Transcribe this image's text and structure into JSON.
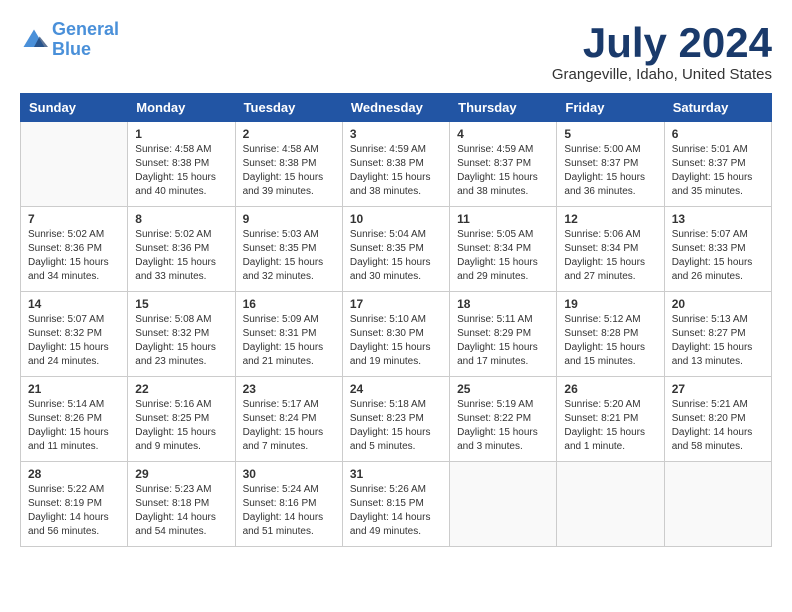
{
  "header": {
    "logo_line1": "General",
    "logo_line2": "Blue",
    "month_title": "July 2024",
    "location": "Grangeville, Idaho, United States"
  },
  "days_of_week": [
    "Sunday",
    "Monday",
    "Tuesday",
    "Wednesday",
    "Thursday",
    "Friday",
    "Saturday"
  ],
  "weeks": [
    [
      {
        "day": "",
        "content": ""
      },
      {
        "day": "1",
        "content": "Sunrise: 4:58 AM\nSunset: 8:38 PM\nDaylight: 15 hours\nand 40 minutes."
      },
      {
        "day": "2",
        "content": "Sunrise: 4:58 AM\nSunset: 8:38 PM\nDaylight: 15 hours\nand 39 minutes."
      },
      {
        "day": "3",
        "content": "Sunrise: 4:59 AM\nSunset: 8:38 PM\nDaylight: 15 hours\nand 38 minutes."
      },
      {
        "day": "4",
        "content": "Sunrise: 4:59 AM\nSunset: 8:37 PM\nDaylight: 15 hours\nand 38 minutes."
      },
      {
        "day": "5",
        "content": "Sunrise: 5:00 AM\nSunset: 8:37 PM\nDaylight: 15 hours\nand 36 minutes."
      },
      {
        "day": "6",
        "content": "Sunrise: 5:01 AM\nSunset: 8:37 PM\nDaylight: 15 hours\nand 35 minutes."
      }
    ],
    [
      {
        "day": "7",
        "content": "Sunrise: 5:02 AM\nSunset: 8:36 PM\nDaylight: 15 hours\nand 34 minutes."
      },
      {
        "day": "8",
        "content": "Sunrise: 5:02 AM\nSunset: 8:36 PM\nDaylight: 15 hours\nand 33 minutes."
      },
      {
        "day": "9",
        "content": "Sunrise: 5:03 AM\nSunset: 8:35 PM\nDaylight: 15 hours\nand 32 minutes."
      },
      {
        "day": "10",
        "content": "Sunrise: 5:04 AM\nSunset: 8:35 PM\nDaylight: 15 hours\nand 30 minutes."
      },
      {
        "day": "11",
        "content": "Sunrise: 5:05 AM\nSunset: 8:34 PM\nDaylight: 15 hours\nand 29 minutes."
      },
      {
        "day": "12",
        "content": "Sunrise: 5:06 AM\nSunset: 8:34 PM\nDaylight: 15 hours\nand 27 minutes."
      },
      {
        "day": "13",
        "content": "Sunrise: 5:07 AM\nSunset: 8:33 PM\nDaylight: 15 hours\nand 26 minutes."
      }
    ],
    [
      {
        "day": "14",
        "content": "Sunrise: 5:07 AM\nSunset: 8:32 PM\nDaylight: 15 hours\nand 24 minutes."
      },
      {
        "day": "15",
        "content": "Sunrise: 5:08 AM\nSunset: 8:32 PM\nDaylight: 15 hours\nand 23 minutes."
      },
      {
        "day": "16",
        "content": "Sunrise: 5:09 AM\nSunset: 8:31 PM\nDaylight: 15 hours\nand 21 minutes."
      },
      {
        "day": "17",
        "content": "Sunrise: 5:10 AM\nSunset: 8:30 PM\nDaylight: 15 hours\nand 19 minutes."
      },
      {
        "day": "18",
        "content": "Sunrise: 5:11 AM\nSunset: 8:29 PM\nDaylight: 15 hours\nand 17 minutes."
      },
      {
        "day": "19",
        "content": "Sunrise: 5:12 AM\nSunset: 8:28 PM\nDaylight: 15 hours\nand 15 minutes."
      },
      {
        "day": "20",
        "content": "Sunrise: 5:13 AM\nSunset: 8:27 PM\nDaylight: 15 hours\nand 13 minutes."
      }
    ],
    [
      {
        "day": "21",
        "content": "Sunrise: 5:14 AM\nSunset: 8:26 PM\nDaylight: 15 hours\nand 11 minutes."
      },
      {
        "day": "22",
        "content": "Sunrise: 5:16 AM\nSunset: 8:25 PM\nDaylight: 15 hours\nand 9 minutes."
      },
      {
        "day": "23",
        "content": "Sunrise: 5:17 AM\nSunset: 8:24 PM\nDaylight: 15 hours\nand 7 minutes."
      },
      {
        "day": "24",
        "content": "Sunrise: 5:18 AM\nSunset: 8:23 PM\nDaylight: 15 hours\nand 5 minutes."
      },
      {
        "day": "25",
        "content": "Sunrise: 5:19 AM\nSunset: 8:22 PM\nDaylight: 15 hours\nand 3 minutes."
      },
      {
        "day": "26",
        "content": "Sunrise: 5:20 AM\nSunset: 8:21 PM\nDaylight: 15 hours\nand 1 minute."
      },
      {
        "day": "27",
        "content": "Sunrise: 5:21 AM\nSunset: 8:20 PM\nDaylight: 14 hours\nand 58 minutes."
      }
    ],
    [
      {
        "day": "28",
        "content": "Sunrise: 5:22 AM\nSunset: 8:19 PM\nDaylight: 14 hours\nand 56 minutes."
      },
      {
        "day": "29",
        "content": "Sunrise: 5:23 AM\nSunset: 8:18 PM\nDaylight: 14 hours\nand 54 minutes."
      },
      {
        "day": "30",
        "content": "Sunrise: 5:24 AM\nSunset: 8:16 PM\nDaylight: 14 hours\nand 51 minutes."
      },
      {
        "day": "31",
        "content": "Sunrise: 5:26 AM\nSunset: 8:15 PM\nDaylight: 14 hours\nand 49 minutes."
      },
      {
        "day": "",
        "content": ""
      },
      {
        "day": "",
        "content": ""
      },
      {
        "day": "",
        "content": ""
      }
    ]
  ]
}
